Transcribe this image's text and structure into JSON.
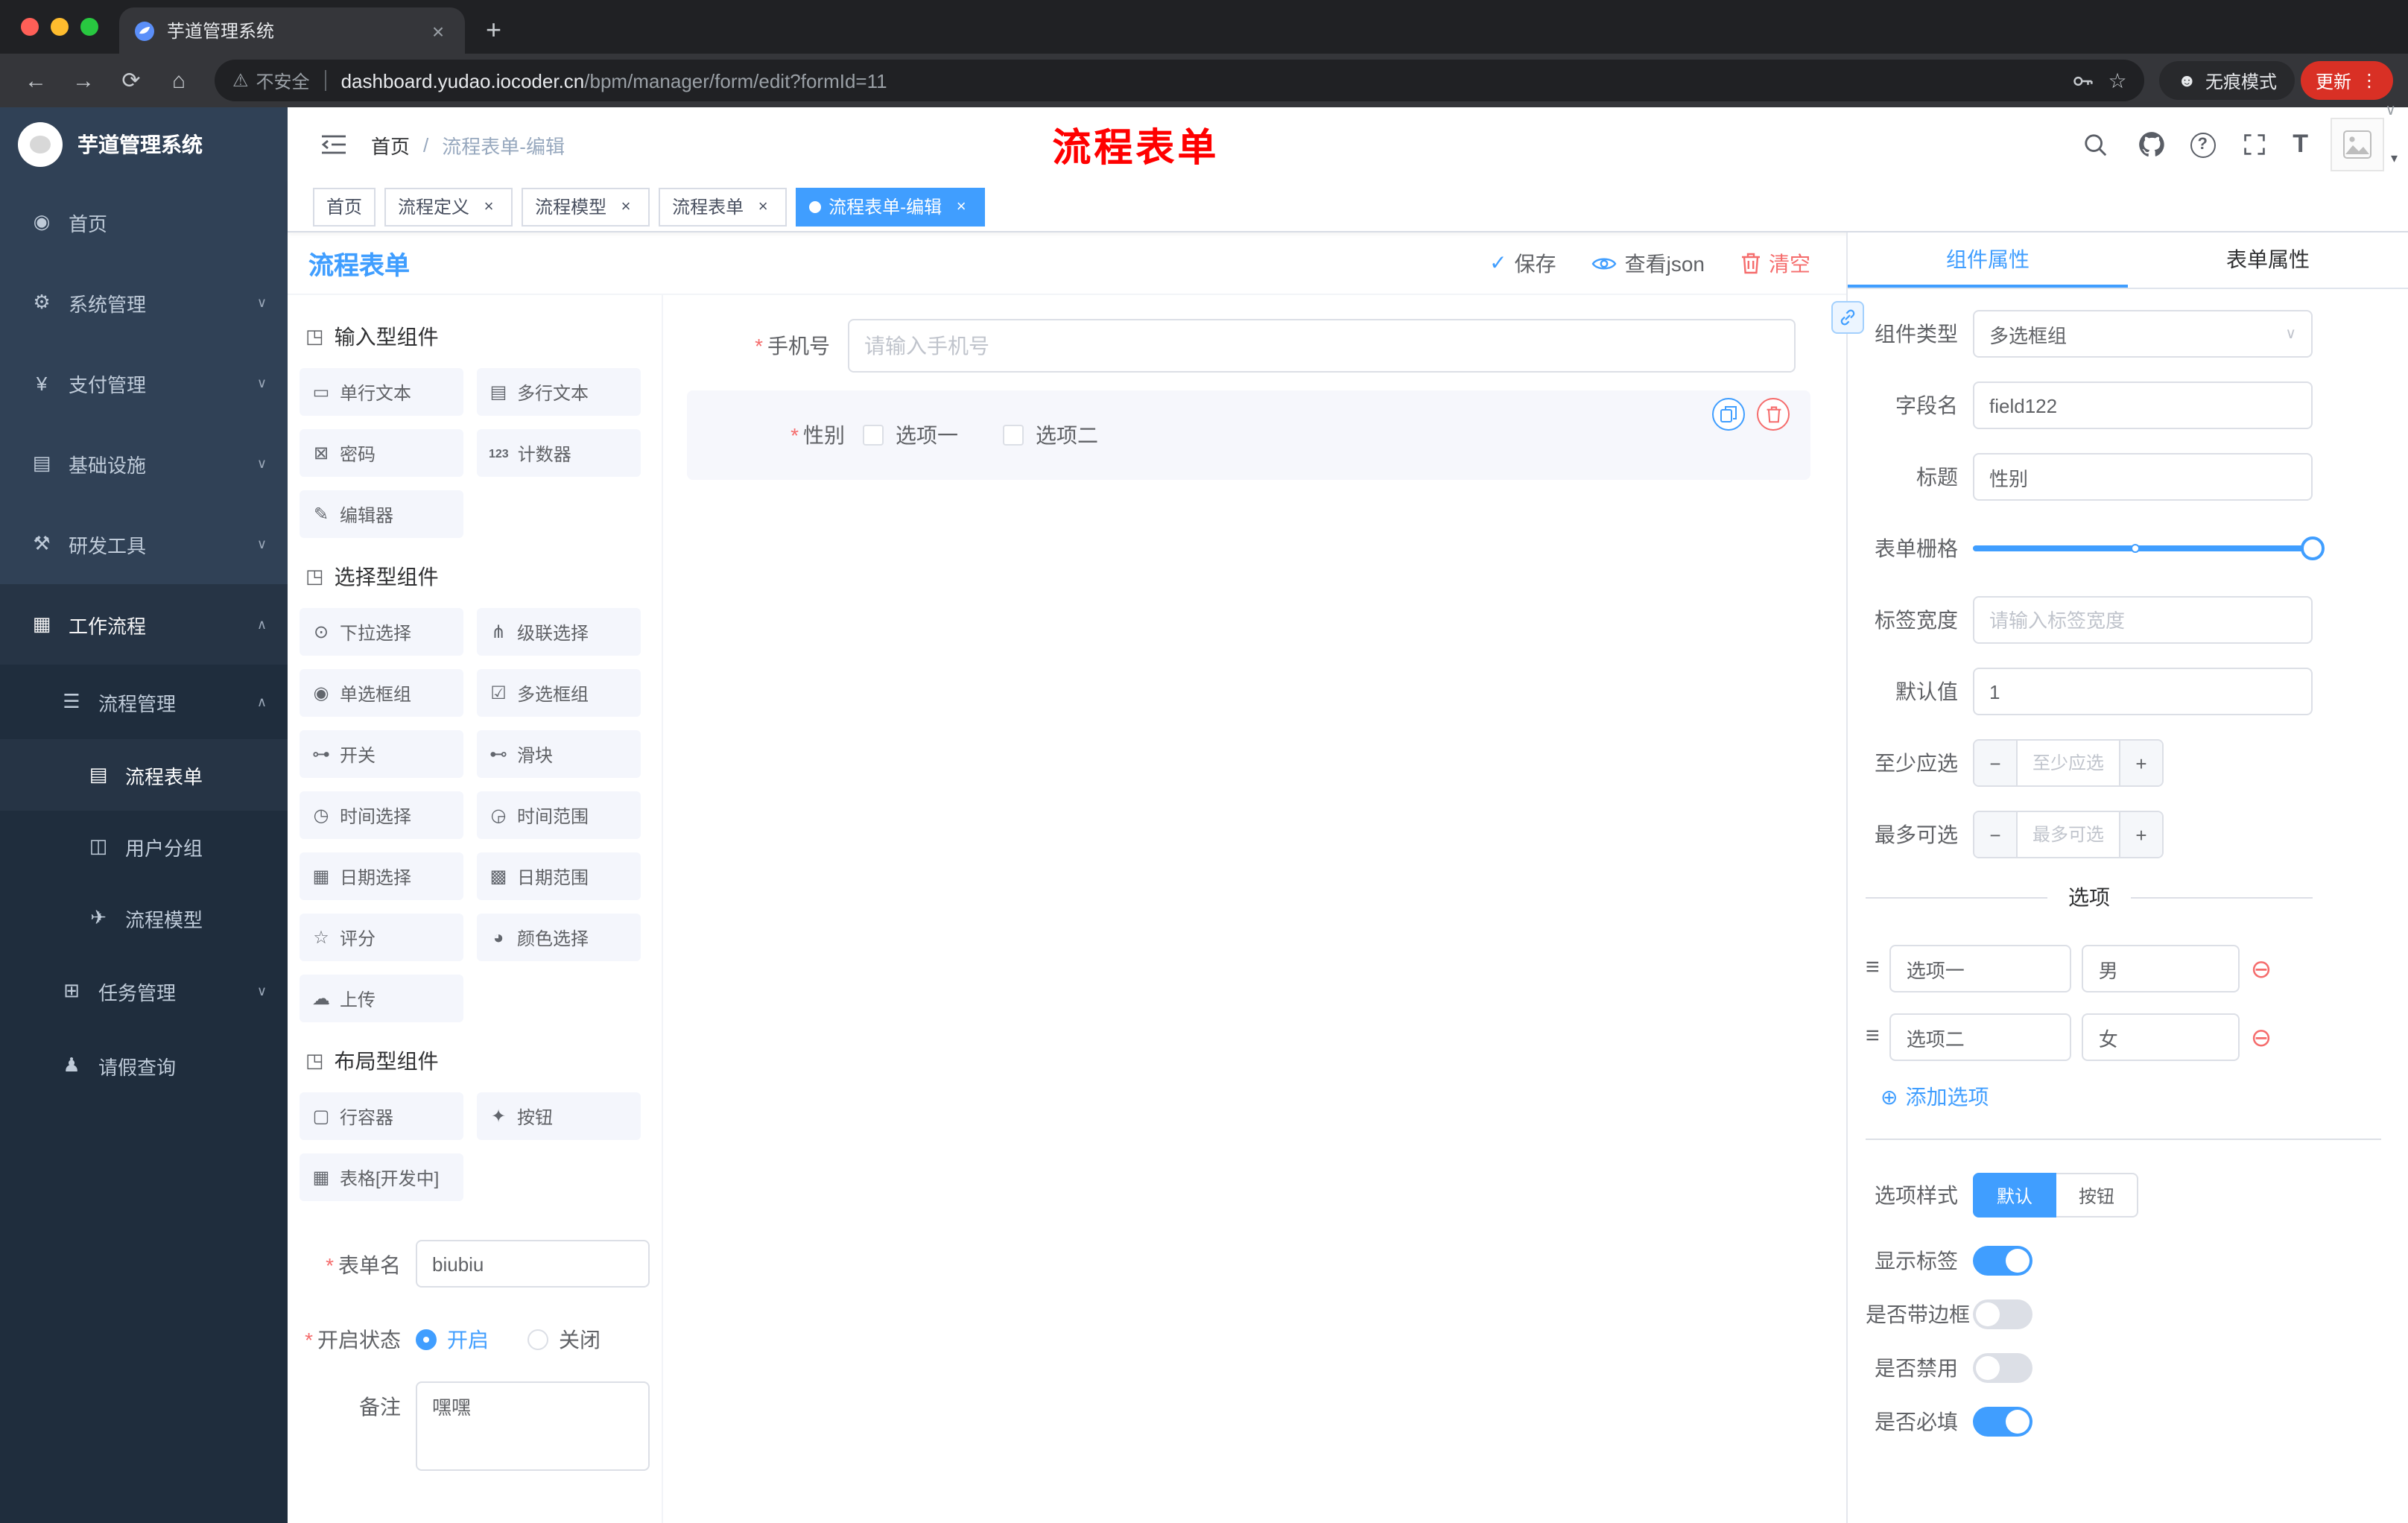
{
  "colors": {
    "accent": "#409eff",
    "danger": "#f56c6c",
    "sidebar_bg": "#304156",
    "sidebar_sub_bg": "#1f2d3d",
    "annotation_red": "#ff0000",
    "tag_active": "#409eff",
    "update_pill": "#d93025"
  },
  "icons": {
    "back": "←",
    "forward": "→",
    "reload": "⟳",
    "home": "⌂",
    "warning": "⚠",
    "star": "☆",
    "incognito_face": "☻",
    "kebab": "⋮",
    "new_tab": "+",
    "close": "×",
    "chevron_down": "∨",
    "chevron_up": "∧",
    "breadcrumb_separator": "/",
    "check": "✓",
    "drag_handle": "≡",
    "remove_circle": "⊖",
    "add_circle": "⊕",
    "select_caret": "∨",
    "avatar_caret": "▾",
    "question": "?",
    "font_size": "T",
    "group_cube": "◳"
  },
  "browser": {
    "tab_title": "芋道管理系统",
    "security_label": "不安全",
    "url_host": "dashboard.yudao.iocoder.cn",
    "url_path": "/bpm/manager/form/edit?formId=11",
    "incognito_label": "无痕模式",
    "update_label": "更新"
  },
  "sidebar": {
    "logo_text": "芋道管理系统",
    "items": [
      {
        "label": "首页",
        "glyph": "◉"
      },
      {
        "label": "系统管理",
        "glyph": "⚙"
      },
      {
        "label": "支付管理",
        "glyph": "¥"
      },
      {
        "label": "基础设施",
        "glyph": "▤"
      },
      {
        "label": "研发工具",
        "glyph": "⚒"
      },
      {
        "label": "工作流程",
        "glyph": "▦",
        "open": true
      },
      {
        "label": "流程管理",
        "glyph": "☰",
        "open": true
      },
      {
        "label": "流程表单",
        "glyph": "▤",
        "active": true
      },
      {
        "label": "用户分组",
        "glyph": "◫"
      },
      {
        "label": "流程模型",
        "glyph": "✈"
      },
      {
        "label": "任务管理",
        "glyph": "⊞"
      },
      {
        "label": "请假查询",
        "glyph": "♟"
      }
    ]
  },
  "app_header": {
    "breadcrumb": [
      "首页",
      "流程表单-编辑"
    ],
    "annotation": "流程表单"
  },
  "tags_view": [
    {
      "label": "首页",
      "closable": false,
      "active": false
    },
    {
      "label": "流程定义",
      "closable": true,
      "active": false
    },
    {
      "label": "流程模型",
      "closable": true,
      "active": false
    },
    {
      "label": "流程表单",
      "closable": true,
      "active": false
    },
    {
      "label": "流程表单-编辑",
      "closable": true,
      "active": true
    }
  ],
  "designer": {
    "title": "流程表单",
    "actions": {
      "save": "保存",
      "view_json": "查看json",
      "clear": "清空"
    },
    "palette_groups": [
      {
        "title": "输入型组件",
        "items": [
          {
            "label": "单行文本",
            "glyph": "▭"
          },
          {
            "label": "多行文本",
            "glyph": "▤"
          },
          {
            "label": "密码",
            "glyph": "⊠"
          },
          {
            "label": "计数器",
            "glyph": "123"
          },
          {
            "label": "编辑器",
            "glyph": "✎"
          }
        ]
      },
      {
        "title": "选择型组件",
        "items": [
          {
            "label": "下拉选择",
            "glyph": "⊙"
          },
          {
            "label": "级联选择",
            "glyph": "⋔"
          },
          {
            "label": "单选框组",
            "glyph": "◉"
          },
          {
            "label": "多选框组",
            "glyph": "☑"
          },
          {
            "label": "开关",
            "glyph": "⊶"
          },
          {
            "label": "滑块",
            "glyph": "⊷"
          },
          {
            "label": "时间选择",
            "glyph": "◷"
          },
          {
            "label": "时间范围",
            "glyph": "◶"
          },
          {
            "label": "日期选择",
            "glyph": "▦"
          },
          {
            "label": "日期范围",
            "glyph": "▩"
          },
          {
            "label": "评分",
            "glyph": "☆"
          },
          {
            "label": "颜色选择",
            "glyph": "◕"
          },
          {
            "label": "上传",
            "glyph": "☁"
          }
        ]
      },
      {
        "title": "布局型组件",
        "items": [
          {
            "label": "行容器",
            "glyph": "▢"
          },
          {
            "label": "按钮",
            "glyph": "✦"
          },
          {
            "label": "表格[开发中]",
            "glyph": "▦"
          }
        ]
      }
    ],
    "meta_form": {
      "form_name": {
        "label": "表单名",
        "value": "biubiu"
      },
      "status": {
        "label": "开启状态",
        "options": [
          {
            "label": "开启",
            "selected": true
          },
          {
            "label": "关闭",
            "selected": false
          }
        ]
      },
      "remark": {
        "label": "备注",
        "value": "嘿嘿"
      }
    },
    "canvas": {
      "phone_field": {
        "label": "手机号",
        "placeholder": "请输入手机号"
      },
      "gender_field": {
        "label": "性别",
        "options": [
          "选项一",
          "选项二"
        ]
      }
    }
  },
  "properties": {
    "tabs": [
      {
        "label": "组件属性",
        "active": true
      },
      {
        "label": "表单属性",
        "active": false
      }
    ],
    "component_type": {
      "label": "组件类型",
      "value": "多选框组"
    },
    "field_name": {
      "label": "字段名",
      "value": "field122"
    },
    "title": {
      "label": "标题",
      "value": "性别"
    },
    "grid": {
      "label": "表单栅格",
      "fill_percent": 100,
      "stop_percent": 48
    },
    "label_width": {
      "label": "标签宽度",
      "placeholder": "请输入标签宽度"
    },
    "default_value": {
      "label": "默认值",
      "value": "1"
    },
    "min_select": {
      "label": "至少应选",
      "placeholder": "至少应选"
    },
    "max_select": {
      "label": "最多可选",
      "placeholder": "最多可选"
    },
    "options_divider": "选项",
    "options": [
      {
        "name": "选项一",
        "value": "男"
      },
      {
        "name": "选项二",
        "value": "女"
      }
    ],
    "add_option_label": "添加选项",
    "option_style": {
      "label": "选项样式",
      "choices": [
        {
          "label": "默认",
          "active": true
        },
        {
          "label": "按钮",
          "active": false
        }
      ]
    },
    "switches": [
      {
        "label": "显示标签",
        "on": true
      },
      {
        "label": "是否带边框",
        "on": false
      },
      {
        "label": "是否禁用",
        "on": false
      },
      {
        "label": "是否必填",
        "on": true
      }
    ]
  }
}
